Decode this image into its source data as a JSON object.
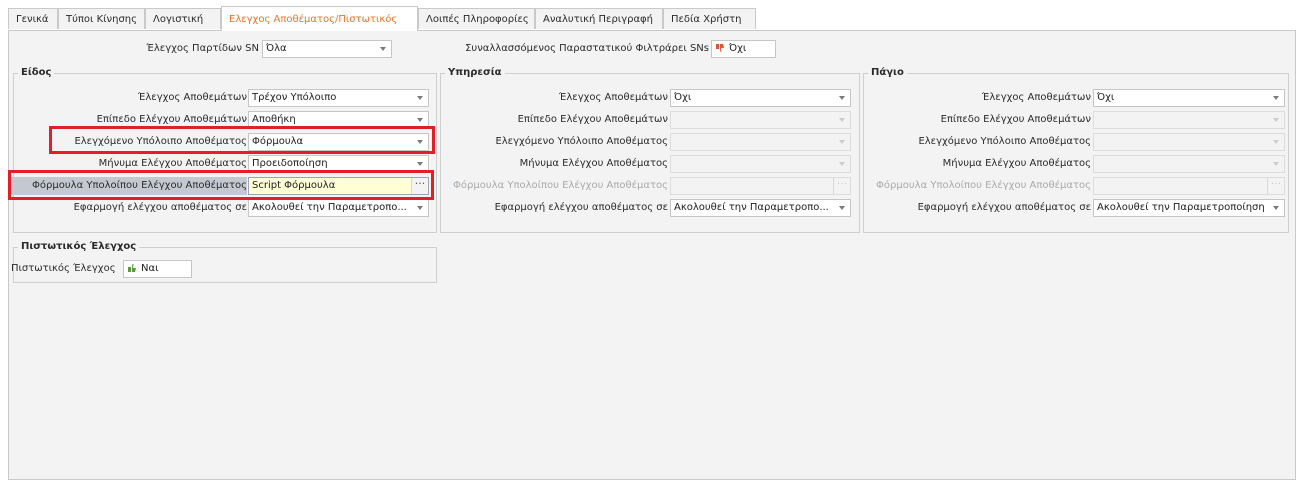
{
  "tabs": [
    {
      "label": "Γενικά"
    },
    {
      "label": "Τύποι Κίνησης"
    },
    {
      "label": "Λογιστική"
    },
    {
      "label": "Ελεγχος Αποθέματος/Πιστωτικός"
    },
    {
      "label": "Λοιπές Πληροφορίες"
    },
    {
      "label": "Αναλυτική Περιγραφή"
    },
    {
      "label": "Πεδία Χρήστη"
    }
  ],
  "top": {
    "batch_label": "Έλεγχος Παρτίδων SN",
    "batch_value": "Όλα",
    "filter_label": "Συναλλασσόμενος Παραστατικού Φιλτράρει SNs",
    "filter_value": "Όχι"
  },
  "colors": {
    "highlight": "#e01f26",
    "active_tab": "#e8762b",
    "yes_icon": "#5a9a3a",
    "no_icon": "#e0533b"
  },
  "groups": {
    "eidos": {
      "title": "Είδος",
      "rows": [
        {
          "label": "Έλεγχος Αποθεμάτων",
          "value": "Τρέχον Υπόλοιπο"
        },
        {
          "label": "Επίπεδο Ελέγχου Αποθεμάτων",
          "value": "Αποθήκη"
        },
        {
          "label": "Ελεγχόμενο Υπόλοιπο Αποθέματος",
          "value": "Φόρμουλα"
        },
        {
          "label": "Μήνυμα Ελέγχου Αποθέματος",
          "value": "Προειδοποίηση"
        },
        {
          "label": "Φόρμουλα Υπολοίπου Ελέγχου Αποθέματος",
          "value": "Script Φόρμουλα"
        },
        {
          "label": "Εφαρμογή ελέγχου αποθέματος σε",
          "value": "Ακολουθεί την Παραμετροπο..."
        }
      ]
    },
    "ypiresia": {
      "title": "Υπηρεσία",
      "rows": [
        {
          "label": "Έλεγχος Αποθεμάτων",
          "value": "Όχι"
        },
        {
          "label": "Επίπεδο Ελέγχου Αποθεμάτων",
          "value": ""
        },
        {
          "label": "Ελεγχόμενο Υπόλοιπο Αποθέματος",
          "value": ""
        },
        {
          "label": "Μήνυμα Ελέγχου Αποθέματος",
          "value": ""
        },
        {
          "label": "Φόρμουλα Υπολοίπου Ελέγχου Αποθέματος",
          "value": ""
        },
        {
          "label": "Εφαρμογή ελέγχου αποθέματος σε",
          "value": "Ακολουθεί την Παραμετροπο..."
        }
      ]
    },
    "pagio": {
      "title": "Πάγιο",
      "rows": [
        {
          "label": "Έλεγχος Αποθεμάτων",
          "value": "Όχι"
        },
        {
          "label": "Επίπεδο Ελέγχου Αποθεμάτων",
          "value": ""
        },
        {
          "label": "Ελεγχόμενο Υπόλοιπο Αποθέματος",
          "value": ""
        },
        {
          "label": "Μήνυμα Ελέγχου Αποθέματος",
          "value": ""
        },
        {
          "label": "Φόρμουλα Υπολοίπου Ελέγχου Αποθέματος",
          "value": ""
        },
        {
          "label": "Εφαρμογή ελέγχου αποθέματος σε",
          "value": "Ακολουθεί την Παραμετροποίηση"
        }
      ]
    },
    "credit": {
      "title": "Πιστωτικός Έλεγχος",
      "label": "Πιστωτικός Έλεγχος",
      "value": "Ναι"
    }
  }
}
